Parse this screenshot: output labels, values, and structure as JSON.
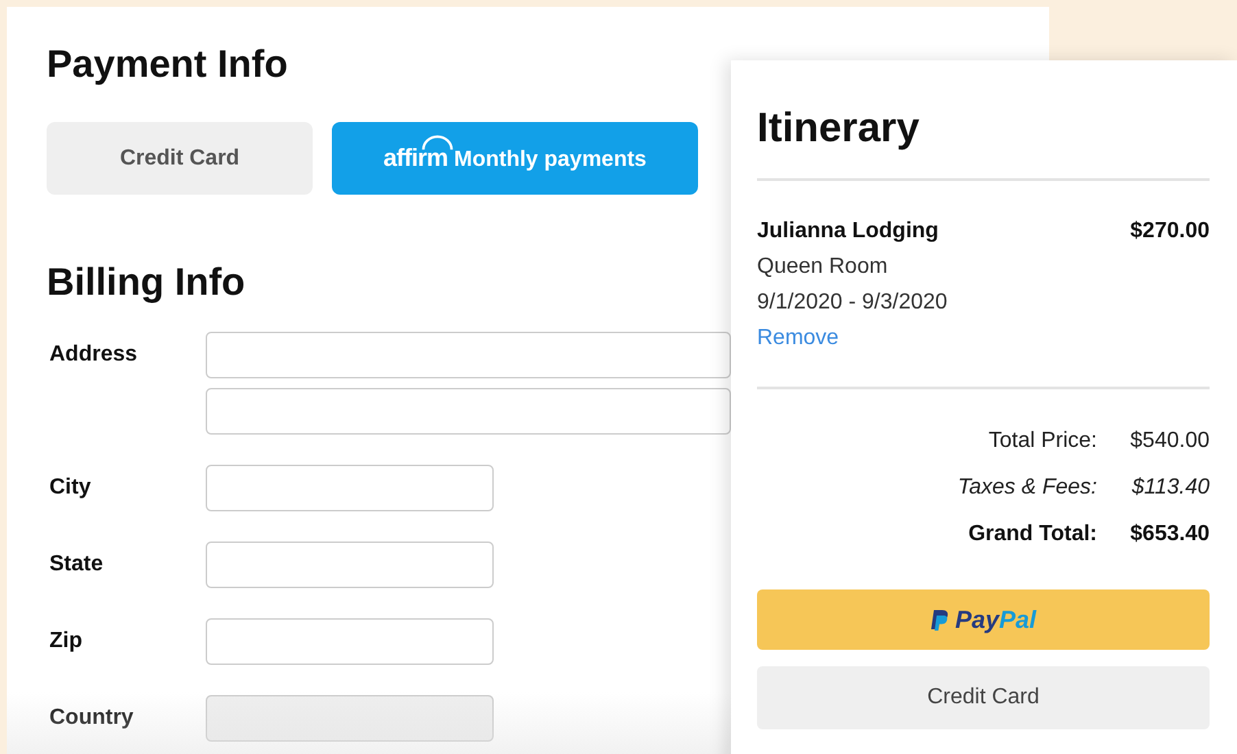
{
  "payment": {
    "title": "Payment Info",
    "methods": [
      {
        "kind": "plain",
        "label": "Credit Card",
        "selected": false
      },
      {
        "kind": "affirm",
        "logo": "affirm",
        "label": "Monthly payments",
        "selected": true
      }
    ]
  },
  "billing": {
    "title": "Billing Info",
    "fields": [
      {
        "label": "Address",
        "inputs": [
          {
            "disabled": false,
            "wide": true
          },
          {
            "disabled": false,
            "wide": true
          }
        ]
      },
      {
        "label": "City",
        "inputs": [
          {
            "disabled": false,
            "wide": false
          }
        ]
      },
      {
        "label": "State",
        "inputs": [
          {
            "disabled": false,
            "wide": false
          }
        ]
      },
      {
        "label": "Zip",
        "inputs": [
          {
            "disabled": false,
            "wide": false
          }
        ]
      },
      {
        "label": "Country",
        "inputs": [
          {
            "disabled": true,
            "wide": false
          }
        ]
      }
    ]
  },
  "itinerary": {
    "title": "Itinerary",
    "item": {
      "name": "Julianna Lodging",
      "price": "$270.00",
      "room": "Queen Room",
      "dates": "9/1/2020 - 9/3/2020",
      "remove": "Remove"
    },
    "totals": [
      {
        "kind": "normal",
        "label": "Total Price:",
        "value": "$540.00"
      },
      {
        "kind": "italic",
        "label": "Taxes & Fees:",
        "value": "$113.40"
      },
      {
        "kind": "bold",
        "label": "Grand Total:",
        "value": "$653.40"
      }
    ],
    "buttons": [
      {
        "kind": "paypal",
        "label_dark": "Pay",
        "label_light": "Pal"
      },
      {
        "kind": "plain",
        "label": "Credit Card"
      }
    ]
  }
}
